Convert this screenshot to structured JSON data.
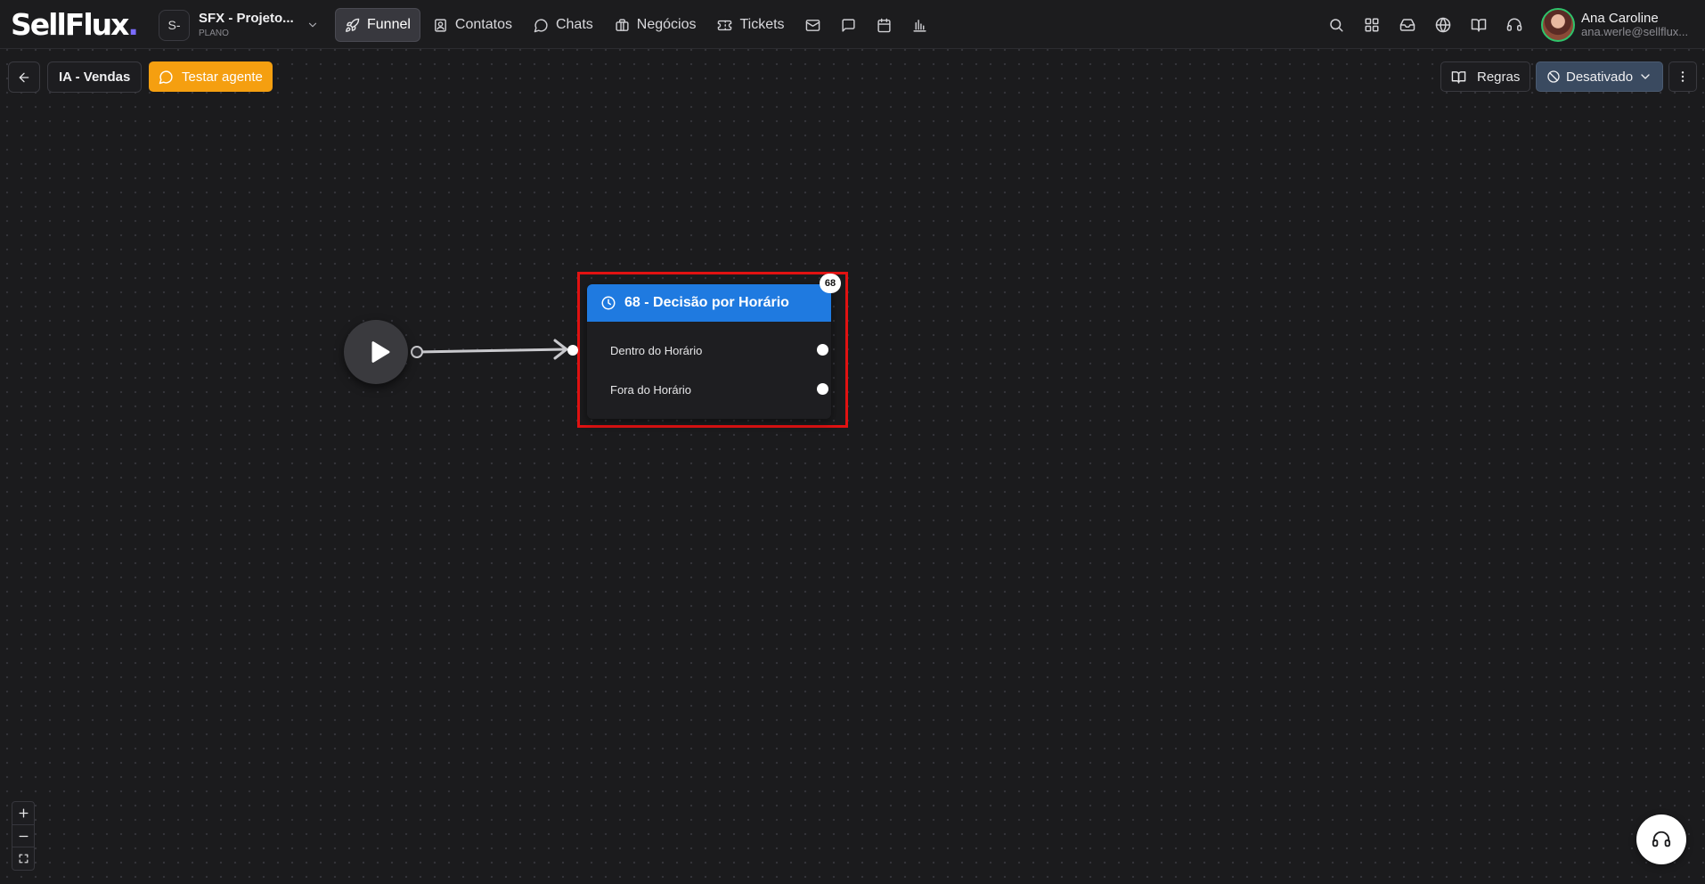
{
  "app": {
    "logo_text": "SellFlux",
    "logo_dot": "."
  },
  "project": {
    "initial": "S-",
    "name": "SFX - Projeto...",
    "plan": "PLANO"
  },
  "nav": {
    "items": [
      {
        "label": "Funnel",
        "icon": "rocket-icon",
        "active": true
      },
      {
        "label": "Contatos",
        "icon": "contacts-icon",
        "active": false
      },
      {
        "label": "Chats",
        "icon": "chat-bubble-icon",
        "active": false
      },
      {
        "label": "Negócios",
        "icon": "briefcase-icon",
        "active": false
      },
      {
        "label": "Tickets",
        "icon": "ticket-icon",
        "active": false
      }
    ],
    "icon_items": [
      "mail-icon",
      "message-square-icon",
      "calendar-icon",
      "bar-chart-icon"
    ]
  },
  "header_right_icons": [
    "search-icon",
    "apps-grid-icon",
    "inbox-icon",
    "globe-icon",
    "book-open-icon",
    "headset-icon"
  ],
  "user": {
    "name": "Ana Caroline",
    "email": "ana.werle@sellflux..."
  },
  "toolbar": {
    "agent_name": "IA - Vendas",
    "test_label": "Testar agente",
    "rules_label": "Regras",
    "status_label": "Desativado"
  },
  "flow": {
    "node": {
      "id_badge": "68",
      "title": "68 - Decisão por Horário",
      "outputs": [
        {
          "label": "Dentro do Horário"
        },
        {
          "label": "Fora do Horário"
        }
      ]
    }
  },
  "colors": {
    "accent_orange": "#f59f10",
    "node_header_blue": "#1f7ae0",
    "status_button": "#3a4a60",
    "highlight_red": "#e11212",
    "logo_dot": "#7b6cff"
  }
}
